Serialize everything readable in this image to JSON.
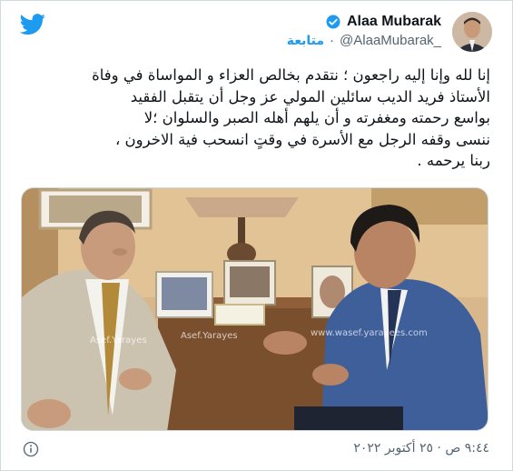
{
  "author": {
    "display_name": "Alaa Mubarak",
    "handle": "@AlaaMubarak_",
    "follow_label": "متابعة",
    "separator": "·"
  },
  "tweet": {
    "text": "إنا لله وإنا إليه راجعون ؛ نتقدم بخالص العزاء و المواساة في وفاة\nالأستاذ فريد الديب سائلين المولي عز وجل أن يتقبل الفقيد\nبواسع رحمته ومغفرته و أن  يلهم أهله الصبر والسلوان ؛لا\nننسى وقفه الرجل مع الأسرة في وقتٍ انسحب فية الاخرون ،\nربنا يرحمه .",
    "timestamp": "٩:٤٤ ص · ٢٥ أكتوبر ٢٠٢٢"
  },
  "media": {
    "watermarks": [
      "Asef.Yarayes",
      "Asef.Yarayes",
      "www.wasef.yarayees.com"
    ]
  },
  "icons": {
    "logo": "twitter-bird-icon",
    "verified": "verified-badge-icon",
    "info": "info-icon"
  },
  "colors": {
    "brand": "#1d9bf0",
    "text": "#0f1419",
    "muted": "#536471"
  }
}
